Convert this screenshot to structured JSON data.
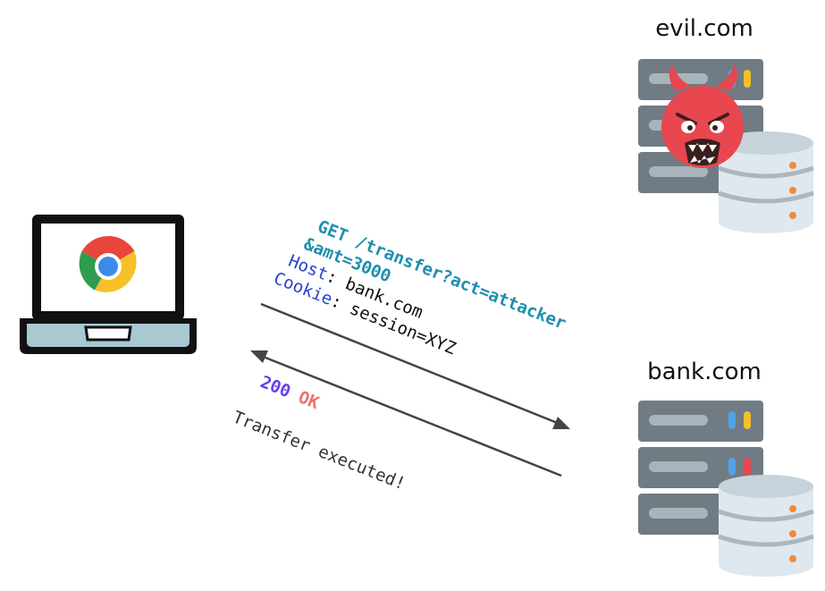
{
  "servers": {
    "evil": {
      "label": "evil.com"
    },
    "bank": {
      "label": "bank.com"
    }
  },
  "request": {
    "line1": "GET /transfer?act=attacker",
    "line2": "&amt=3000",
    "host_key": "Host",
    "host_value": ": bank.com",
    "cookie_key": "Cookie",
    "cookie_value": ": session=XYZ"
  },
  "response": {
    "status_code": "200",
    "status_text": "OK",
    "body": "Transfer executed!"
  },
  "colors": {
    "get_teal": "#1f8fb0",
    "header_key_blue": "#2a44c9",
    "status_code_purple": "#6a3de8",
    "status_text_red": "#f07070",
    "server_gray": "#707b84",
    "server_slot": "#a9b3bb",
    "db_light": "#dfe8ee",
    "db_band": "#a9b7c0",
    "devil_red": "#e8474f",
    "laptop_frame": "#111111",
    "laptop_body": "#a8c8d2",
    "arrow": "#444444"
  },
  "icons": {
    "client": "laptop-icon",
    "browser": "chrome-icon",
    "attacker": "devil-icon",
    "server": "server-icon",
    "database": "database-icon"
  }
}
